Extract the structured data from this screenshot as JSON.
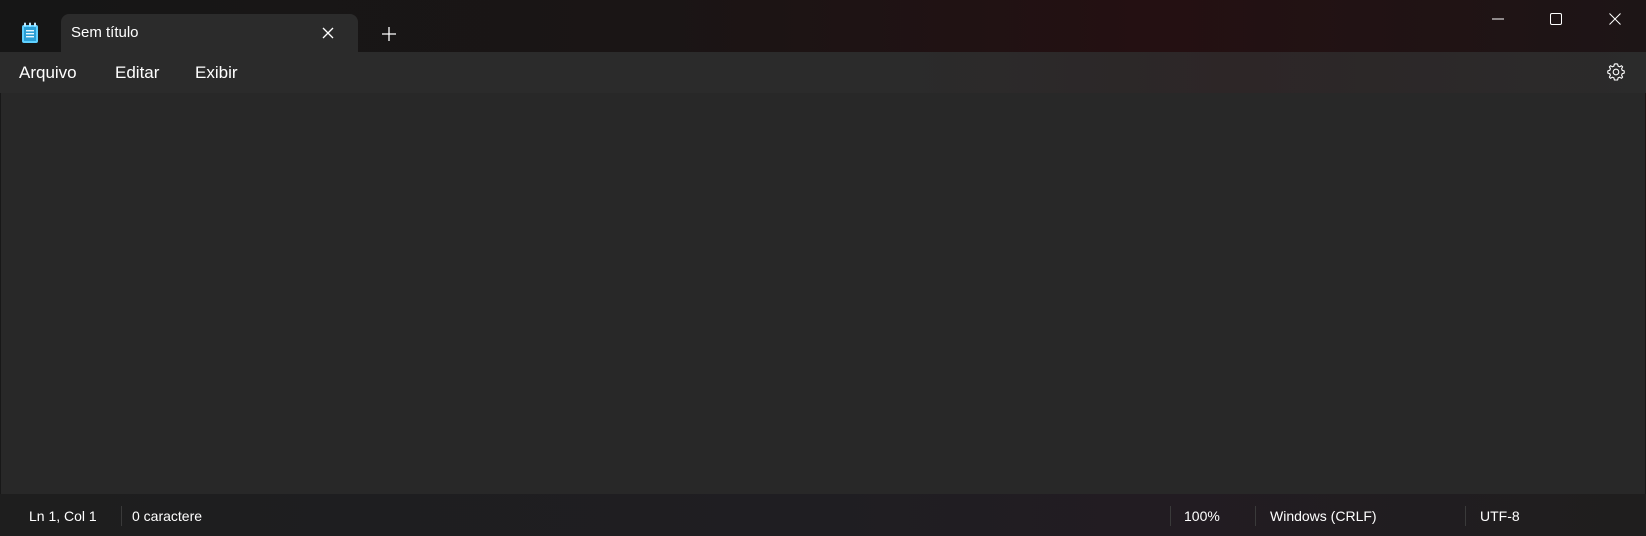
{
  "window": {
    "tab_title": "Sem título",
    "icons": {
      "app": "notepad-icon",
      "tab_close": "close-icon",
      "new_tab": "plus-icon",
      "minimize": "minimize-icon",
      "maximize": "maximize-icon",
      "close": "close-icon"
    }
  },
  "menu": {
    "items": [
      {
        "label": "Arquivo"
      },
      {
        "label": "Editar"
      },
      {
        "label": "Exibir"
      }
    ],
    "settings_icon": "gear-icon"
  },
  "editor": {
    "content": ""
  },
  "status": {
    "position": "Ln 1, Col 1",
    "characters": "0 caractere",
    "zoom": "100%",
    "line_ending": "Windows (CRLF)",
    "encoding": "UTF-8"
  },
  "colors": {
    "accent_icon": "#4cc2ff",
    "editor_bg": "#282828",
    "menubar_bg": "#2b2b2b"
  }
}
